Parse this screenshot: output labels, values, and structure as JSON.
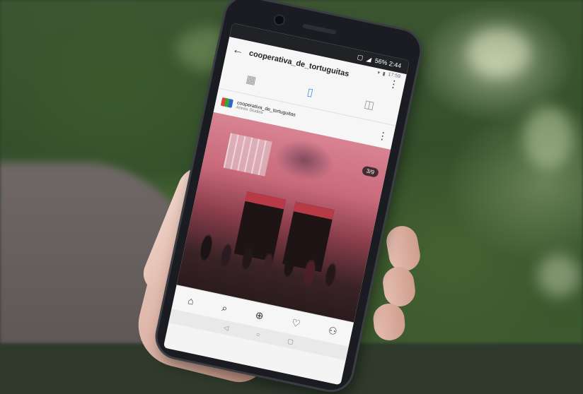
{
  "phone": {
    "status_bar": {
      "battery_time": "56% 2:44"
    },
    "app_status": {
      "time": "17:59"
    },
    "header": {
      "username": "cooperativa_de_tortuguitas",
      "more_label": "⋮"
    },
    "post": {
      "account": "cooperativa_de_tortuguitas",
      "location": "Annex Studios",
      "more_label": "⋮",
      "image_counter": "3/9"
    },
    "icons": {
      "grid": "grid-icon",
      "scroll": "scroll-feed-icon",
      "tagged": "tagged-icon",
      "home": "home-icon",
      "search": "search-icon",
      "add": "add-post-icon",
      "activity": "heart-icon",
      "profile": "profile-icon"
    },
    "colors": {
      "accent": "#4a90e2",
      "photo_tint": "#c96a7b"
    }
  }
}
